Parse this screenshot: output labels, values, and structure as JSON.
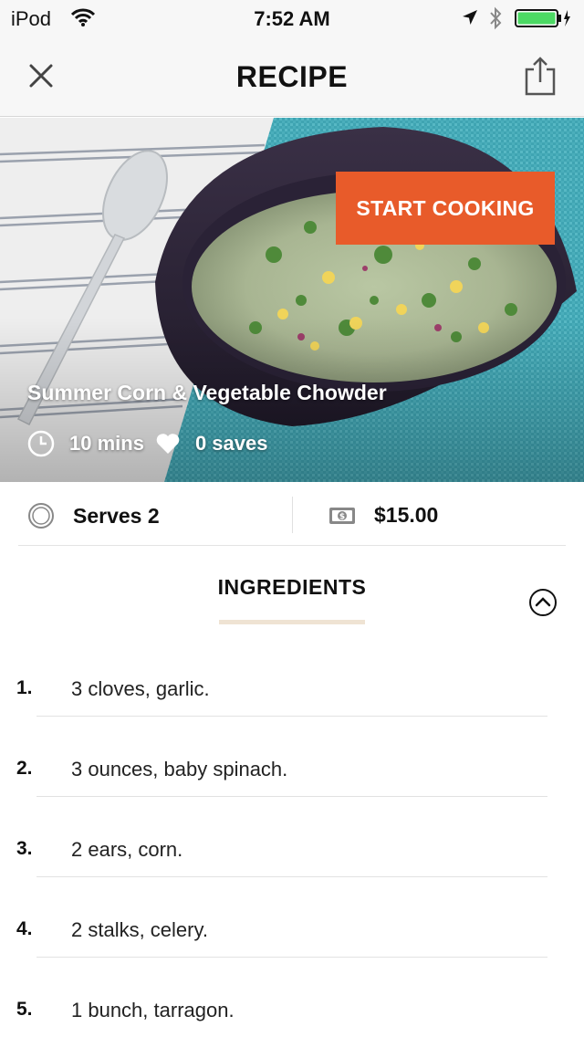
{
  "status_bar": {
    "carrier": "iPod",
    "time": "7:52 AM"
  },
  "nav": {
    "title": "RECIPE"
  },
  "hero": {
    "start_button": "START COOKING",
    "title": "Summer Corn & Vegetable Chowder",
    "time": "10 mins",
    "saves": "0 saves"
  },
  "info": {
    "serves": "Serves 2",
    "cost": "$15.00"
  },
  "ingredients": {
    "header": "INGREDIENTS",
    "items": [
      {
        "num": "1.",
        "text": "3 cloves, garlic."
      },
      {
        "num": "2.",
        "text": "3 ounces, baby spinach."
      },
      {
        "num": "3.",
        "text": "2 ears, corn."
      },
      {
        "num": "4.",
        "text": "2 stalks, celery."
      },
      {
        "num": "5.",
        "text": "1 bunch, tarragon."
      }
    ]
  },
  "colors": {
    "accent": "#e85b2a",
    "underline": "#efe3d3",
    "battery": "#4cd964"
  },
  "icons": [
    "wifi-icon",
    "location-arrow-icon",
    "bluetooth-icon",
    "battery-icon",
    "close-icon",
    "share-icon",
    "clock-icon",
    "heart-icon",
    "serves-icon",
    "money-icon",
    "chevron-up-icon"
  ]
}
